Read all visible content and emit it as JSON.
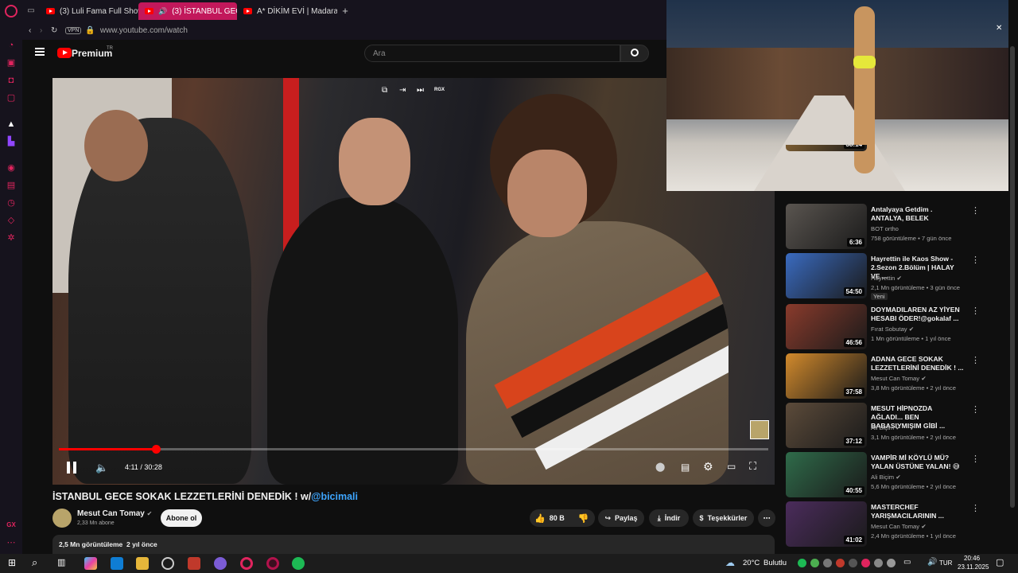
{
  "tabs": [
    {
      "label": "(3) Luli Fama Full Show in"
    },
    {
      "label": "(3) İSTANBUL GECE S"
    },
    {
      "label": "A* DİKİM EVİ | Madara Ol"
    }
  ],
  "address": {
    "vpn": "VPN",
    "url": "www.youtube.com/watch"
  },
  "header": {
    "brand": "Premium",
    "brand_sup": "TR",
    "search_placeholder": "Ara"
  },
  "player": {
    "time": "4:11 / 30:28",
    "progress": 0.137,
    "top_badge": "RGX"
  },
  "video": {
    "title": "İSTANBUL GECE SOKAK LEZZETLERİNİ DENEDİK ! w/",
    "title_link": "@bicimali",
    "channel": "Mesut Can Tomay",
    "subs": "2,33 Mn abone",
    "subscribe": "Abone ol",
    "likes": "80 B",
    "share": "Paylaş",
    "download": "İndir",
    "thanks": "Teşekkürler",
    "views": "2,5 Mn görüntüleme",
    "age": "2 yıl önce"
  },
  "recommended": [
    {
      "title": "",
      "duration": "38:14",
      "channel": "",
      "meta": ""
    },
    {
      "title": "Antalyaya Getdim . ANTALYA, BELEK",
      "duration": "6:36",
      "channel": "BOT ortho",
      "meta": "758 görüntüleme • 7 gün önce",
      "verified": false
    },
    {
      "title": "Hayrettin ile Kaos Show - 2.Sezon 2.Bölüm | HALAY VE ...",
      "duration": "54:50",
      "channel": "Hayrettin",
      "meta": "2,1 Mn görüntüleme • 3 gün önce",
      "badge": "Yeni",
      "verified": true
    },
    {
      "title": "DOYMADILAREN AZ YİYEN HESABI ÖDER!@gokalaf ...",
      "duration": "46:56",
      "channel": "Fırat Sobutay",
      "meta": "1 Mn görüntüleme • 1 yıl önce",
      "verified": true
    },
    {
      "title": "ADANA GECE SOKAK LEZZETLERİNİ DENEDİK ! ...",
      "duration": "37:58",
      "channel": "Mesut Can Tomay",
      "meta": "3,8 Mn görüntüleme • 2 yıl önce",
      "verified": true
    },
    {
      "title": "MESUT HİPNOZDA AĞLADI... BEN BABASIYMIŞIM GİBİ ...",
      "duration": "37:12",
      "channel": "Ali Biçim",
      "meta": "3,1 Mn görüntüleme • 2 yıl önce",
      "verified": true
    },
    {
      "title": "VAMPİR Mİ KÖYLÜ MÜ? YALAN ÜSTÜNE YALAN! 😅",
      "duration": "40:55",
      "channel": "Ali Biçim",
      "meta": "5,6 Mn görüntüleme • 2 yıl önce",
      "verified": true
    },
    {
      "title": "MASTERCHEF YARIŞMACILARININ ...",
      "duration": "41:02",
      "channel": "Mesut Can Tomay",
      "meta": "2,4 Mn görüntüleme • 1 yıl önce",
      "verified": true
    }
  ],
  "taskbar": {
    "weather": "20°C",
    "weather_desc": "Bulutlu",
    "lang": "TUR",
    "time": "20:46",
    "date": "23.11.2025"
  },
  "sidebar_bottom": "GX"
}
